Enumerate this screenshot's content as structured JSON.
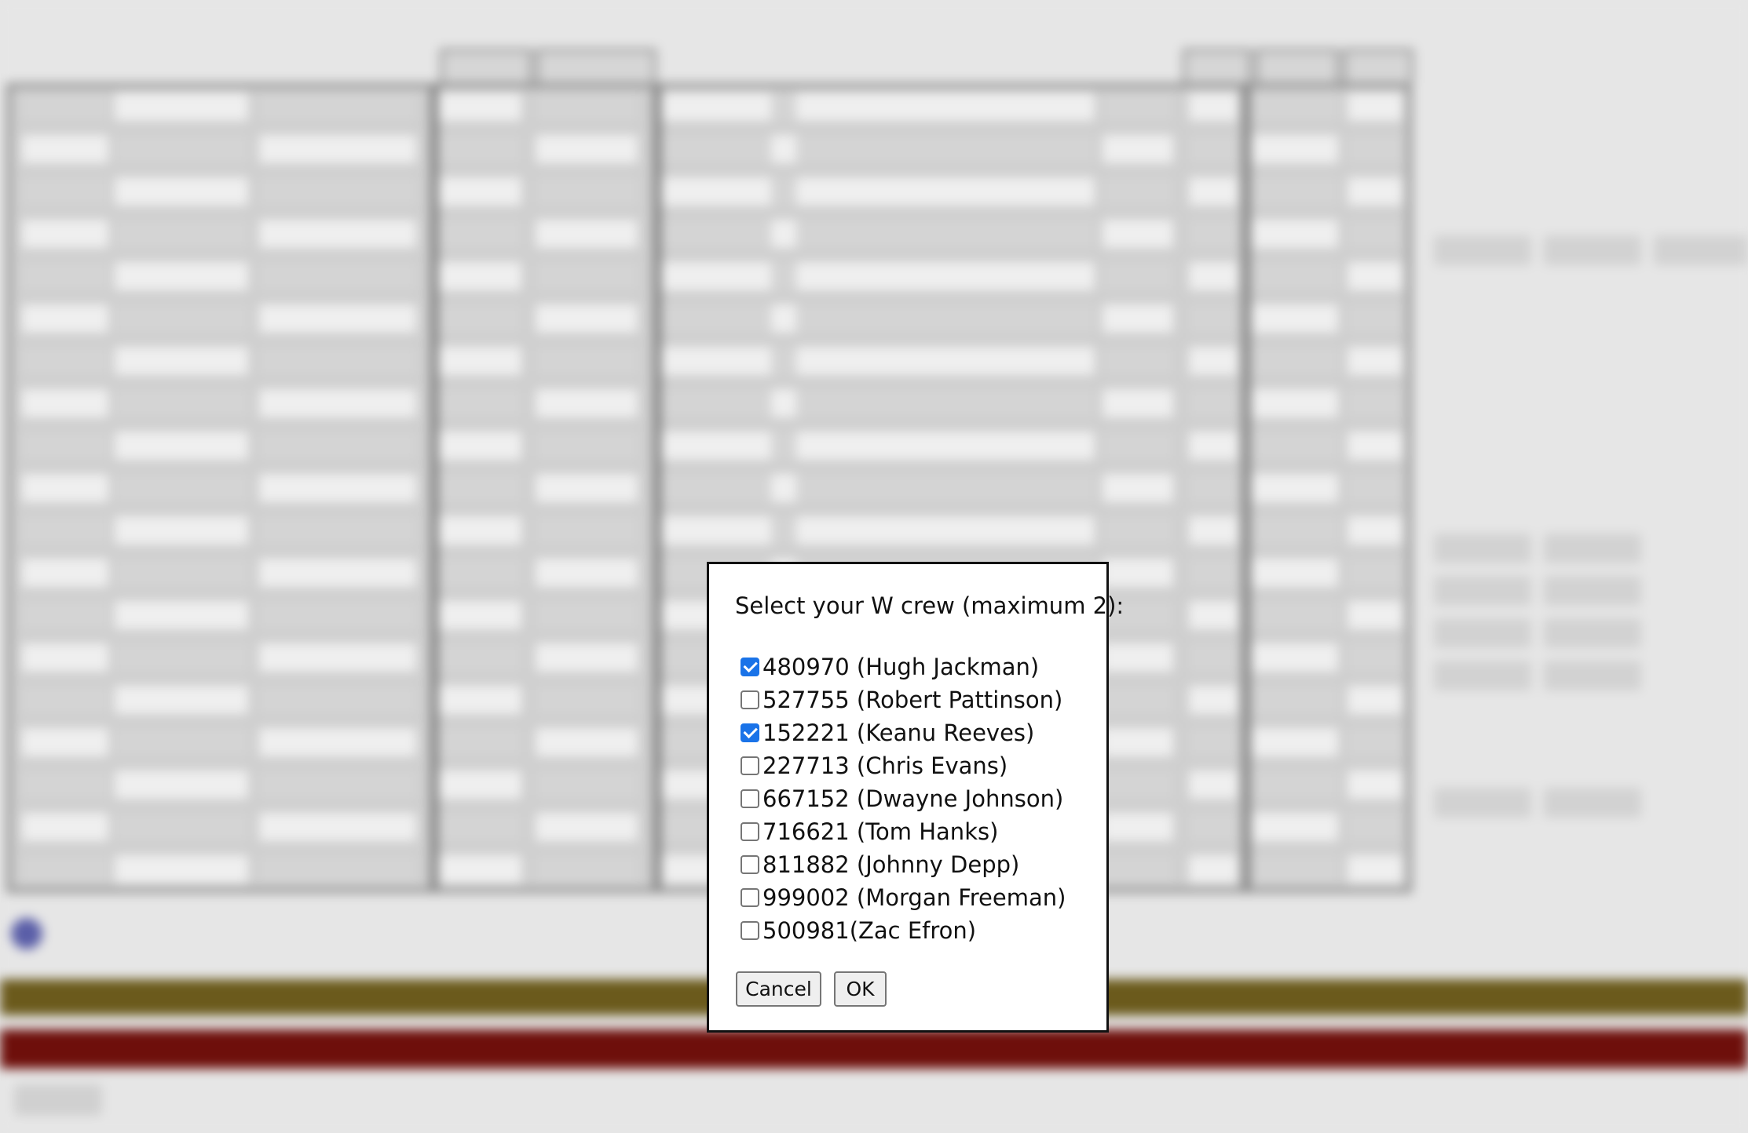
{
  "dialog": {
    "prompt": "Select your  W crew (maximum 2):",
    "options": [
      {
        "label": "480970 (Hugh Jackman)",
        "checked": true
      },
      {
        "label": "527755 (Robert Pattinson)",
        "checked": false
      },
      {
        "label": "152221 (Keanu Reeves)",
        "checked": true
      },
      {
        "label": "227713 (Chris Evans)",
        "checked": false
      },
      {
        "label": "667152 (Dwayne Johnson)",
        "checked": false
      },
      {
        "label": "716621 (Tom Hanks)",
        "checked": false
      },
      {
        "label": "811882 (Johnny Depp)",
        "checked": false
      },
      {
        "label": "999002 (Morgan Freeman)",
        "checked": false
      },
      {
        "label": "500981(Zac Efron)",
        "checked": false
      }
    ],
    "cancel_label": "Cancel",
    "ok_label": "OK"
  },
  "colors": {
    "checkbox_checked": "#1a73e8",
    "band_olive": "#6b5a1c",
    "band_red": "#6e0f0b",
    "overlay_bg": "#e6e6e6"
  }
}
